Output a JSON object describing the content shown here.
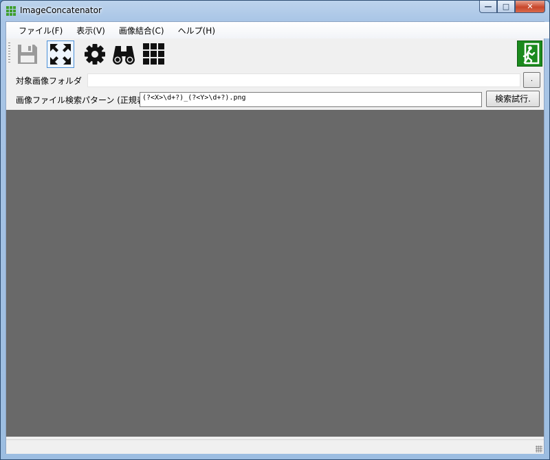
{
  "window": {
    "title": "ImageConcatenator"
  },
  "caption_buttons": {
    "minimize": "—",
    "maximize": "□",
    "close": "✕"
  },
  "menu": [
    {
      "label": "ファイル(F)"
    },
    {
      "label": "表示(V)"
    },
    {
      "label": "画像結合(C)"
    },
    {
      "label": "ヘルプ(H)"
    }
  ],
  "toolbar": {
    "buttons": [
      {
        "icon": "save-icon",
        "enabled": false
      },
      {
        "icon": "fullscreen-icon",
        "active": true
      },
      {
        "icon": "gear-icon"
      },
      {
        "icon": "binoculars-icon"
      },
      {
        "icon": "grid-icon"
      }
    ],
    "exit_icon": "exit-door-icon",
    "exit_color": "#1b8a1d"
  },
  "folder": {
    "label": "対象画像フォルダ",
    "value": "",
    "browse_label": "."
  },
  "pattern": {
    "label": "画像ファイル検索パターン (正規表",
    "value": "(?<X>\\d+?)_(?<Y>\\d+?).png",
    "test_button": "検索試行."
  },
  "colors": {
    "canvas": "#696969",
    "accent": "#1b8a1d"
  }
}
